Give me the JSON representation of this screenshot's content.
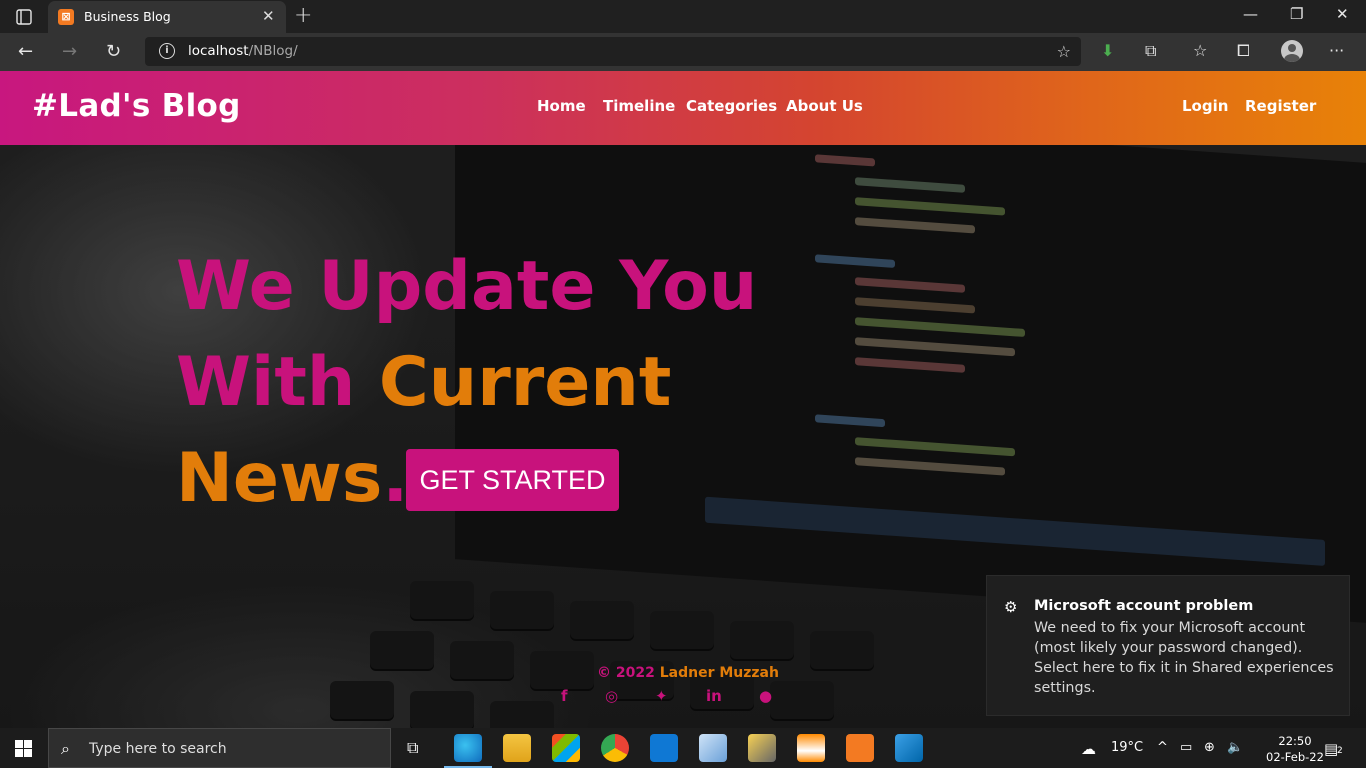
{
  "browser": {
    "tab_title": "Business Blog",
    "url_host": "localhost",
    "url_path": "/NBlog/",
    "icons": [
      "tab-actions-icon",
      "close-icon",
      "new-tab-icon",
      "minimize-icon",
      "maximize-icon",
      "window-close-icon",
      "back-icon",
      "forward-icon",
      "refresh-icon",
      "info-icon",
      "add-favorite-icon",
      "download-icon",
      "extensions-icon",
      "favorites-icon",
      "collections-icon",
      "profile-icon",
      "more-icon"
    ]
  },
  "site": {
    "brand": "#Lad's Blog",
    "nav": [
      "Home",
      "Timeline",
      "Categories",
      "About Us"
    ],
    "auth": [
      "Login",
      "Register"
    ],
    "hero": {
      "line1": "We Update You",
      "line2a": "With ",
      "line2b": "Current",
      "line3a": "News",
      "line3b": "."
    },
    "cta": "GET STARTED",
    "footer": {
      "copyright": "© 2022",
      "author": " Ladner Muzzah"
    },
    "social_icons": [
      "facebook-icon",
      "instagram-icon",
      "twitter-icon",
      "linkedin-icon",
      "pinterest-icon"
    ],
    "colors": {
      "pink": "#c8127c",
      "orange": "#e27d0a"
    }
  },
  "notification": {
    "title": "Microsoft account problem",
    "body": "We need to fix your Microsoft account (most likely your password changed). Select here to fix it in Shared experiences settings."
  },
  "taskbar": {
    "search_placeholder": "Type here to search",
    "weather": "19°C",
    "time": "22:50",
    "date": "02-Feb-22",
    "notification_count": "2"
  }
}
